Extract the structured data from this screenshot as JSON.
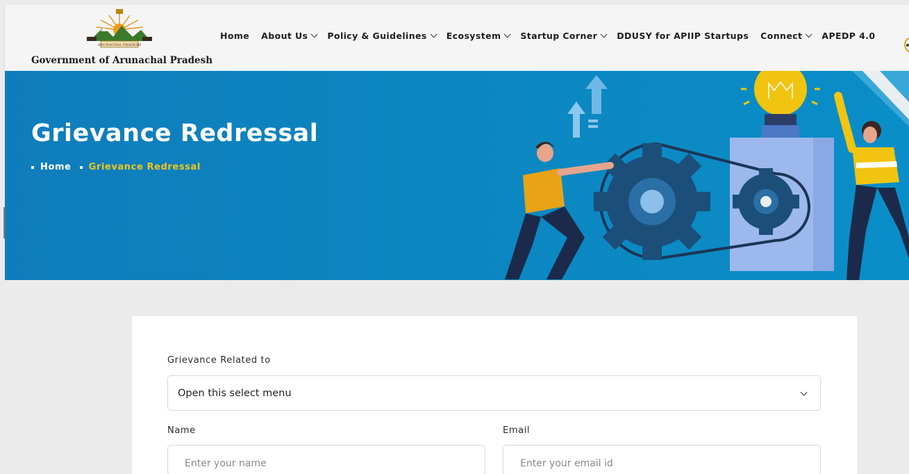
{
  "header": {
    "logo_text": "Government of Arunachal Pradesh",
    "emblem_text": "ARUNACHAL PRADESH",
    "nav": [
      {
        "label": "Home",
        "dropdown": false
      },
      {
        "label": "About Us",
        "dropdown": true
      },
      {
        "label": "Policy & Guidelines",
        "dropdown": true
      },
      {
        "label": "Ecosystem",
        "dropdown": true
      },
      {
        "label": "Startup Corner",
        "dropdown": true
      },
      {
        "label": "DDUSY for APIIP Startups",
        "dropdown": false
      },
      {
        "label": "Connect",
        "dropdown": true
      },
      {
        "label": "APEDP 4.0",
        "dropdown": false
      }
    ]
  },
  "banner": {
    "title": "Grievance Redressal",
    "breadcrumb_home": "Home",
    "breadcrumb_current": "Grievance Redressal"
  },
  "form": {
    "grievance_label": "Grievance Related to",
    "grievance_selected": "Open this select menu",
    "name_label": "Name",
    "name_placeholder": "Enter your name",
    "email_label": "Email",
    "email_placeholder": "Enter your email id"
  },
  "colors": {
    "banner_blue": "#0c86c0",
    "breadcrumb_accent": "#f5c518",
    "page_bg": "#ebebeb"
  }
}
